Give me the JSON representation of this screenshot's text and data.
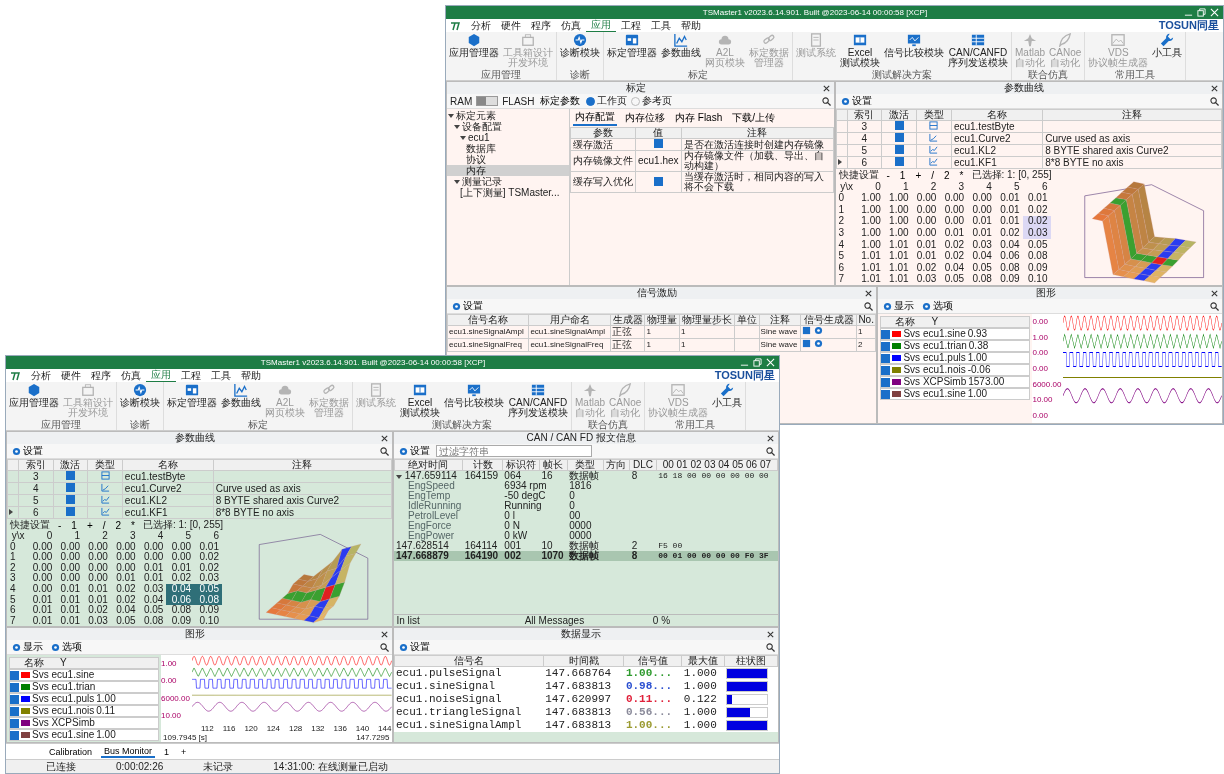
{
  "windows": [
    {
      "title": "TSMaster1 v2023.6.14.901. Built @2023-06-14 00:00:58 [XCP]",
      "brand": "TOSUN同星",
      "menu": [
        {
          "label": "分析",
          "selected": false
        },
        {
          "label": "硬件",
          "selected": false
        },
        {
          "label": "程序",
          "selected": false
        },
        {
          "label": "仿真",
          "selected": false
        },
        {
          "label": "应用",
          "selected": true
        },
        {
          "label": "工程",
          "selected": false
        },
        {
          "label": "工具",
          "selected": false
        },
        {
          "label": "帮助",
          "selected": false
        }
      ],
      "ribbon": [
        {
          "group": "应用管理",
          "buttons": [
            {
              "lines": [
                "应用管理器"
              ],
              "kind": "hex",
              "disabled": false
            },
            {
              "lines": [
                "工具箱设计",
                "开发环境"
              ],
              "kind": "box",
              "disabled": true
            }
          ]
        },
        {
          "group": "诊断",
          "buttons": [
            {
              "lines": [
                "诊断模块"
              ],
              "kind": "pulse",
              "disabled": false
            }
          ]
        },
        {
          "group": "标定",
          "buttons": [
            {
              "lines": [
                "标定管理器"
              ],
              "kind": "window",
              "disabled": false
            },
            {
              "lines": [
                "参数曲线"
              ],
              "kind": "chart",
              "disabled": false
            },
            {
              "lines": [
                "A2L",
                "网页模块"
              ],
              "kind": "cloud",
              "disabled": true
            },
            {
              "lines": [
                "标定数据",
                "管理器"
              ],
              "kind": "link",
              "disabled": true
            }
          ]
        },
        {
          "group": "测试解决方案",
          "buttons": [
            {
              "lines": [
                "测试系统"
              ],
              "kind": "doc",
              "disabled": true
            },
            {
              "lines": [
                "Excel",
                "测试模块"
              ],
              "kind": "sheet",
              "disabled": false
            },
            {
              "lines": [
                "信号比较模块"
              ],
              "kind": "monitor",
              "disabled": false
            },
            {
              "lines": [
                "CAN/CANFD",
                "序列发送模块"
              ],
              "kind": "table",
              "disabled": false
            }
          ]
        },
        {
          "group": "联合仿真",
          "buttons": [
            {
              "lines": [
                "Matlab",
                "自动化"
              ],
              "kind": "plane",
              "disabled": true
            },
            {
              "lines": [
                "CANoe",
                "自动化"
              ],
              "kind": "feather",
              "disabled": true
            }
          ]
        },
        {
          "group": "常用工具",
          "buttons": [
            {
              "lines": [
                "VDS",
                "协议帧生成器"
              ],
              "kind": "image",
              "disabled": true
            },
            {
              "lines": [
                "小工具"
              ],
              "kind": "wrench",
              "disabled": false
            }
          ]
        }
      ],
      "rows": [
        [
          {
            "kind": "calibration",
            "title": "标定",
            "ram": "RAM",
            "flash": "FLASH",
            "flash_selected": false,
            "param_menu": "标定参数",
            "pages": [
              {
                "label": "工作页",
                "selected": true
              },
              {
                "label": "参考页",
                "selected": false
              }
            ],
            "tree": [
              {
                "label": "标定元素",
                "selected": false,
                "expanded": true,
                "children": [
                  {
                    "label": "设备配置",
                    "selected": false,
                    "expanded": true,
                    "children": [
                      {
                        "label": "ecu1",
                        "selected": false,
                        "expanded": true,
                        "children": [
                          {
                            "label": "数据库",
                            "selected": false
                          },
                          {
                            "label": "协议",
                            "selected": false
                          },
                          {
                            "label": "内存",
                            "selected": true
                          }
                        ]
                      }
                    ]
                  },
                  {
                    "label": "测量记录",
                    "selected": false,
                    "expanded": true,
                    "children": [
                      {
                        "label": "[上下测量] TSMaster...",
                        "selected": false
                      }
                    ]
                  }
                ]
              }
            ],
            "tabs": [
              {
                "label": "内存配置",
                "selected": true
              },
              {
                "label": "内存位移",
                "selected": false
              },
              {
                "label": "内存 Flash",
                "selected": false
              },
              {
                "label": "下载/上传",
                "selected": false
              }
            ],
            "columns": [
              "参数",
              "值",
              "注释"
            ],
            "params": [
              {
                "name": "缓存激活",
                "kind": "check",
                "checked": true,
                "note": "是否在激活连接时创建内存镜像"
              },
              {
                "name": "内存镜像文件",
                "kind": "text",
                "value": "ecu1.hex",
                "note": "内存镜像文件（加载、导出、自动构建）"
              },
              {
                "name": "缓存写入优化",
                "kind": "check",
                "checked": true,
                "note": "当缓存激活时，相同内容的写入将不会下载"
              }
            ]
          },
          {
            "kind": "param_curve",
            "title": "参数曲线",
            "settings": "设置",
            "columns": [
              "索引",
              "激活",
              "类型",
              "名称",
              "注释"
            ],
            "items": [
              {
                "index": "3",
                "active": true,
                "kind": "value",
                "name": "ecu1.testByte",
                "selected": false
              },
              {
                "index": "4",
                "active": true,
                "kind": "curve",
                "name": "ecu1.Curve2",
                "note": "Curve used as axis",
                "selected": false
              },
              {
                "index": "5",
                "active": true,
                "kind": "map",
                "name": "ecu1.KL2",
                "note": "8 BYTE shared axis Curve2",
                "selected": false
              },
              {
                "index": "6",
                "active": true,
                "kind": "map",
                "name": "ecu1.KF1",
                "note": "8*8 BYTE no axis",
                "selected": true
              }
            ],
            "quick": "快捷设置",
            "ops": [
              "-",
              "1",
              "+",
              "/",
              "2",
              "*"
            ],
            "selection": "已选择: 1: [0, 255]",
            "corner": "y\\x",
            "map_columns": [
              "0",
              "1",
              "2",
              "3",
              "4",
              "5",
              "6"
            ],
            "map_rows": [
              {
                "label": "0",
                "cells": [
                  {
                    "v": "1.00",
                    "selected": false
                  },
                  {
                    "v": "1.00",
                    "selected": false
                  },
                  {
                    "v": "0.00",
                    "selected": false
                  },
                  {
                    "v": "0.00",
                    "selected": false
                  },
                  {
                    "v": "0.00",
                    "selected": false
                  },
                  {
                    "v": "0.01",
                    "selected": false
                  },
                  {
                    "v": "0.01",
                    "selected": false
                  }
                ]
              },
              {
                "label": "1",
                "cells": [
                  {
                    "v": "1.00",
                    "selected": false
                  },
                  {
                    "v": "1.00",
                    "selected": false
                  },
                  {
                    "v": "0.00",
                    "selected": false
                  },
                  {
                    "v": "0.00",
                    "selected": false
                  },
                  {
                    "v": "0.00",
                    "selected": false
                  },
                  {
                    "v": "0.01",
                    "selected": false
                  },
                  {
                    "v": "0.02",
                    "selected": false
                  }
                ]
              },
              {
                "label": "2",
                "cells": [
                  {
                    "v": "1.00",
                    "selected": false
                  },
                  {
                    "v": "1.00",
                    "selected": false
                  },
                  {
                    "v": "0.00",
                    "selected": false
                  },
                  {
                    "v": "0.00",
                    "selected": false
                  },
                  {
                    "v": "0.01",
                    "selected": false
                  },
                  {
                    "v": "0.01",
                    "selected": false
                  },
                  {
                    "v": "0.02",
                    "selected": true
                  }
                ]
              },
              {
                "label": "3",
                "cells": [
                  {
                    "v": "1.00",
                    "selected": false
                  },
                  {
                    "v": "1.00",
                    "selected": false
                  },
                  {
                    "v": "0.00",
                    "selected": false
                  },
                  {
                    "v": "0.01",
                    "selected": false
                  },
                  {
                    "v": "0.01",
                    "selected": false
                  },
                  {
                    "v": "0.02",
                    "selected": false
                  },
                  {
                    "v": "0.03",
                    "selected": true
                  }
                ]
              },
              {
                "label": "4",
                "cells": [
                  {
                    "v": "1.00",
                    "selected": false
                  },
                  {
                    "v": "1.01",
                    "selected": false
                  },
                  {
                    "v": "0.01",
                    "selected": false
                  },
                  {
                    "v": "0.02",
                    "selected": false
                  },
                  {
                    "v": "0.03",
                    "selected": false
                  },
                  {
                    "v": "0.04",
                    "selected": false
                  },
                  {
                    "v": "0.05",
                    "selected": false
                  }
                ]
              },
              {
                "label": "5",
                "cells": [
                  {
                    "v": "1.01",
                    "selected": false
                  },
                  {
                    "v": "1.01",
                    "selected": false
                  },
                  {
                    "v": "0.01",
                    "selected": false
                  },
                  {
                    "v": "0.02",
                    "selected": false
                  },
                  {
                    "v": "0.04",
                    "selected": false
                  },
                  {
                    "v": "0.06",
                    "selected": false
                  },
                  {
                    "v": "0.08",
                    "selected": false
                  }
                ]
              },
              {
                "label": "6",
                "cells": [
                  {
                    "v": "1.01",
                    "selected": false
                  },
                  {
                    "v": "1.01",
                    "selected": false
                  },
                  {
                    "v": "0.02",
                    "selected": false
                  },
                  {
                    "v": "0.04",
                    "selected": false
                  },
                  {
                    "v": "0.05",
                    "selected": false
                  },
                  {
                    "v": "0.08",
                    "selected": false
                  },
                  {
                    "v": "0.09",
                    "selected": false
                  }
                ]
              },
              {
                "label": "7",
                "cells": [
                  {
                    "v": "1.01",
                    "selected": false
                  },
                  {
                    "v": "1.01",
                    "selected": false
                  },
                  {
                    "v": "0.03",
                    "selected": false
                  },
                  {
                    "v": "0.05",
                    "selected": false
                  },
                  {
                    "v": "0.08",
                    "selected": false
                  },
                  {
                    "v": "0.09",
                    "selected": false
                  },
                  {
                    "v": "0.10",
                    "selected": false
                  }
                ]
              }
            ]
          }
        ],
        [
          {
            "kind": "signal_gen",
            "title": "信号激励",
            "settings": "设置",
            "columns": [
              "信号名称",
              "用户命名",
              "生成器",
              "物理量",
              "物理量步长",
              "单位",
              "注释",
              "信号生成器",
              "No."
            ],
            "items": [
              {
                "name": "ecu1.sineSignalAmpl",
                "user": "ecu1.sineSignalAmpl",
                "gen": "正弦",
                "phys": "1",
                "step": "1",
                "note": "Sine wave",
                "no": "1"
              },
              {
                "name": "ecu1.sineSignalFreq",
                "user": "ecu1.sineSignalFreq",
                "gen": "正弦",
                "phys": "1",
                "step": "1",
                "note": "Sine wave",
                "no": "2"
              }
            ]
          },
          {
            "kind": "graph",
            "title": "图形",
            "menus": [
              "显示",
              "选项"
            ],
            "legend_header": [
              "名称",
              "Y"
            ],
            "legend": [
              {
                "label": "Svs ecu1.sine",
                "value": "0.93",
                "color": "#ff0000",
                "checked": true,
                "kind": "sine"
              },
              {
                "label": "Svs ecu1.trian",
                "value": "0.38",
                "color": "#008000",
                "checked": true,
                "kind": "triangle"
              },
              {
                "label": "Svs ecu1.puls",
                "value": "1.00",
                "color": "#0000ff",
                "checked": true,
                "kind": "square"
              },
              {
                "label": "Svs ecu1.nois",
                "value": "-0.06",
                "color": "#808000",
                "checked": true,
                "kind": "flat"
              },
              {
                "label": "Svs XCPSimb",
                "value": "1573.00",
                "color": "#800080",
                "checked": true,
                "kind": "slow"
              },
              {
                "label": "Svs ecu1.sine",
                "value": "1.00",
                "color": "#804040",
                "checked": true,
                "kind": "none"
              }
            ],
            "y_labels": [
              "0.00",
              "1.00",
              "0.00",
              "0.00",
              "6000.00",
              "10.00",
              "0.00"
            ]
          }
        ]
      ]
    },
    {
      "title": "TSMaster1 v2023.6.14.901. Built @2023-06-14 00:00:58 [XCP]",
      "brand": "TOSUN同星",
      "menu": [
        {
          "label": "分析",
          "selected": false
        },
        {
          "label": "硬件",
          "selected": false
        },
        {
          "label": "程序",
          "selected": false
        },
        {
          "label": "仿真",
          "selected": false
        },
        {
          "label": "应用",
          "selected": true
        },
        {
          "label": "工程",
          "selected": false
        },
        {
          "label": "工具",
          "selected": false
        },
        {
          "label": "帮助",
          "selected": false
        }
      ],
      "ribbon": [
        {
          "group": "应用管理",
          "buttons": [
            {
              "lines": [
                "应用管理器"
              ],
              "kind": "hex",
              "disabled": false
            },
            {
              "lines": [
                "工具箱设计",
                "开发环境"
              ],
              "kind": "box",
              "disabled": true
            }
          ]
        },
        {
          "group": "诊断",
          "buttons": [
            {
              "lines": [
                "诊断模块"
              ],
              "kind": "pulse",
              "disabled": false
            }
          ]
        },
        {
          "group": "标定",
          "buttons": [
            {
              "lines": [
                "标定管理器"
              ],
              "kind": "window",
              "disabled": false
            },
            {
              "lines": [
                "参数曲线"
              ],
              "kind": "chart",
              "disabled": false
            },
            {
              "lines": [
                "A2L",
                "网页模块"
              ],
              "kind": "cloud",
              "disabled": true
            },
            {
              "lines": [
                "标定数据",
                "管理器"
              ],
              "kind": "link",
              "disabled": true
            }
          ]
        },
        {
          "group": "测试解决方案",
          "buttons": [
            {
              "lines": [
                "测试系统"
              ],
              "kind": "doc",
              "disabled": true
            },
            {
              "lines": [
                "Excel",
                "测试模块"
              ],
              "kind": "sheet",
              "disabled": false
            },
            {
              "lines": [
                "信号比较模块"
              ],
              "kind": "monitor",
              "disabled": false
            },
            {
              "lines": [
                "CAN/CANFD",
                "序列发送模块"
              ],
              "kind": "table",
              "disabled": false
            }
          ]
        },
        {
          "group": "联合仿真",
          "buttons": [
            {
              "lines": [
                "Matlab",
                "自动化"
              ],
              "kind": "plane",
              "disabled": true
            },
            {
              "lines": [
                "CANoe",
                "自动化"
              ],
              "kind": "feather",
              "disabled": true
            }
          ]
        },
        {
          "group": "常用工具",
          "buttons": [
            {
              "lines": [
                "VDS",
                "协议帧生成器"
              ],
              "kind": "image",
              "disabled": true
            },
            {
              "lines": [
                "小工具"
              ],
              "kind": "wrench",
              "disabled": false
            }
          ]
        }
      ],
      "rows": [
        [
          {
            "kind": "param_curve",
            "title": "参数曲线",
            "settings": "设置",
            "columns": [
              "索引",
              "激活",
              "类型",
              "名称",
              "注释"
            ],
            "items": [
              {
                "index": "3",
                "active": true,
                "kind": "value",
                "name": "ecu1.testByte",
                "selected": false
              },
              {
                "index": "4",
                "active": true,
                "kind": "curve",
                "name": "ecu1.Curve2",
                "note": "Curve used as axis",
                "selected": false
              },
              {
                "index": "5",
                "active": true,
                "kind": "map",
                "name": "ecu1.KL2",
                "note": "8 BYTE shared axis Curve2",
                "selected": false
              },
              {
                "index": "6",
                "active": true,
                "kind": "map",
                "name": "ecu1.KF1",
                "note": "8*8 BYTE no axis",
                "selected": true
              }
            ],
            "quick": "快捷设置",
            "ops": [
              "-",
              "1",
              "+",
              "/",
              "2",
              "*"
            ],
            "selection": "已选择: 1: [0, 255]",
            "corner": "y\\x",
            "map_columns": [
              "0",
              "1",
              "2",
              "3",
              "4",
              "5",
              "6"
            ],
            "map_rows": [
              {
                "label": "0",
                "cells": [
                  {
                    "v": "0.00",
                    "selected": false
                  },
                  {
                    "v": "0.00",
                    "selected": false
                  },
                  {
                    "v": "0.00",
                    "selected": false
                  },
                  {
                    "v": "0.00",
                    "selected": false
                  },
                  {
                    "v": "0.00",
                    "selected": false
                  },
                  {
                    "v": "0.00",
                    "selected": false
                  },
                  {
                    "v": "0.01",
                    "selected": false
                  }
                ]
              },
              {
                "label": "1",
                "cells": [
                  {
                    "v": "0.00",
                    "selected": false
                  },
                  {
                    "v": "0.00",
                    "selected": false
                  },
                  {
                    "v": "0.00",
                    "selected": false
                  },
                  {
                    "v": "0.00",
                    "selected": false
                  },
                  {
                    "v": "0.00",
                    "selected": false
                  },
                  {
                    "v": "0.00",
                    "selected": false
                  },
                  {
                    "v": "0.02",
                    "selected": false
                  }
                ]
              },
              {
                "label": "2",
                "cells": [
                  {
                    "v": "0.00",
                    "selected": false
                  },
                  {
                    "v": "0.00",
                    "selected": false
                  },
                  {
                    "v": "0.00",
                    "selected": false
                  },
                  {
                    "v": "0.00",
                    "selected": false
                  },
                  {
                    "v": "0.01",
                    "selected": false
                  },
                  {
                    "v": "0.01",
                    "selected": false
                  },
                  {
                    "v": "0.02",
                    "selected": false
                  }
                ]
              },
              {
                "label": "3",
                "cells": [
                  {
                    "v": "0.00",
                    "selected": false
                  },
                  {
                    "v": "0.00",
                    "selected": false
                  },
                  {
                    "v": "0.00",
                    "selected": false
                  },
                  {
                    "v": "0.01",
                    "selected": false
                  },
                  {
                    "v": "0.01",
                    "selected": false
                  },
                  {
                    "v": "0.02",
                    "selected": false
                  },
                  {
                    "v": "0.03",
                    "selected": false
                  }
                ]
              },
              {
                "label": "4",
                "cells": [
                  {
                    "v": "0.00",
                    "selected": false
                  },
                  {
                    "v": "0.01",
                    "selected": false
                  },
                  {
                    "v": "0.01",
                    "selected": false
                  },
                  {
                    "v": "0.02",
                    "selected": false
                  },
                  {
                    "v": "0.03",
                    "selected": false
                  },
                  {
                    "v": "0.04",
                    "selected": true
                  },
                  {
                    "v": "0.05",
                    "selected": true
                  }
                ]
              },
              {
                "label": "5",
                "cells": [
                  {
                    "v": "0.01",
                    "selected": false
                  },
                  {
                    "v": "0.01",
                    "selected": false
                  },
                  {
                    "v": "0.01",
                    "selected": false
                  },
                  {
                    "v": "0.02",
                    "selected": false
                  },
                  {
                    "v": "0.04",
                    "selected": false
                  },
                  {
                    "v": "0.06",
                    "selected": true
                  },
                  {
                    "v": "0.08",
                    "selected": true
                  }
                ]
              },
              {
                "label": "6",
                "cells": [
                  {
                    "v": "0.01",
                    "selected": false
                  },
                  {
                    "v": "0.01",
                    "selected": false
                  },
                  {
                    "v": "0.02",
                    "selected": false
                  },
                  {
                    "v": "0.04",
                    "selected": false
                  },
                  {
                    "v": "0.05",
                    "selected": false
                  },
                  {
                    "v": "0.08",
                    "selected": false
                  },
                  {
                    "v": "0.09",
                    "selected": false
                  }
                ]
              },
              {
                "label": "7",
                "cells": [
                  {
                    "v": "0.01",
                    "selected": false
                  },
                  {
                    "v": "0.01",
                    "selected": false
                  },
                  {
                    "v": "0.03",
                    "selected": false
                  },
                  {
                    "v": "0.05",
                    "selected": false
                  },
                  {
                    "v": "0.08",
                    "selected": false
                  },
                  {
                    "v": "0.09",
                    "selected": false
                  },
                  {
                    "v": "0.10",
                    "selected": false
                  }
                ]
              }
            ]
          },
          {
            "kind": "can_trace",
            "title": "CAN / CAN FD 报文信息",
            "settings": "设置",
            "filter": {
              "placeholder": "过滤字符串"
            },
            "columns": [
              "绝对时间",
              "计数",
              "标识符",
              "帧长",
              "类型",
              "方向",
              "DLC",
              "00 01 02 03 04 05 06 07"
            ],
            "frames": [
              {
                "time": "147.659114",
                "count": "164159",
                "id": "064",
                "len": "16",
                "type": "数据帧",
                "dlc": "8",
                "data": "16 18 00 00 00 00 00 00",
                "selected": false,
                "expanded": true,
                "signals": [
                  {
                    "name": "EngSpeed",
                    "value": "6934 rpm",
                    "raw": "1816"
                  },
                  {
                    "name": "EngTemp",
                    "value": "-50 degC",
                    "raw": "0"
                  },
                  {
                    "name": "IdleRunning",
                    "value": "Running",
                    "raw": "0"
                  },
                  {
                    "name": "PetrolLevel",
                    "value": "0 l",
                    "raw": "00"
                  },
                  {
                    "name": "EngForce",
                    "value": "0 N",
                    "raw": "0000"
                  },
                  {
                    "name": "EngPower",
                    "value": "0 kW",
                    "raw": "0000"
                  }
                ]
              },
              {
                "time": "147.628514",
                "count": "164114",
                "id": "001",
                "len": "10",
                "type": "数据帧",
                "dlc": "2",
                "data": "F5 00",
                "selected": false
              },
              {
                "time": "147.668879",
                "count": "164190",
                "id": "002",
                "len": "1070",
                "type": "数据帧",
                "dlc": "8",
                "data": "00 01 00 00 00 00 F0 3F",
                "selected": true
              }
            ],
            "footer": [
              "In list",
              "All Messages",
              "0 %"
            ]
          }
        ],
        [
          {
            "kind": "graph",
            "title": "图形",
            "menus": [
              "显示",
              "选项"
            ],
            "legend_header": [
              "名称",
              "Y"
            ],
            "legend": [
              {
                "label": "Svs ecu1.sine",
                "color": "#ff0000",
                "checked": true,
                "kind": "sine"
              },
              {
                "label": "Svs ecu1.trian",
                "color": "#008000",
                "checked": true,
                "kind": "triangle"
              },
              {
                "label": "Svs ecu1.puls",
                "value": "1.00",
                "color": "#0000ff",
                "checked": true,
                "kind": "square"
              },
              {
                "label": "Svs ecu1.nois",
                "value": "0.11",
                "color": "#808000",
                "checked": true,
                "kind": "flat"
              },
              {
                "label": "Svs XCPSimb",
                "color": "#800080",
                "checked": true,
                "kind": "slow"
              },
              {
                "label": "Svs ecu1.sine",
                "value": "1.00",
                "color": "#804040",
                "checked": true,
                "kind": "none"
              }
            ],
            "y_labels": [
              "1.00",
              "0.00",
              "6000.00",
              "10.00"
            ],
            "x_labels": [
              "112",
              "116",
              "120",
              "124",
              "128",
              "132",
              "136",
              "140",
              "144"
            ],
            "x_start": "109.7945 [s]",
            "x_end": "147.7295"
          },
          {
            "kind": "data_display",
            "title": "数据显示",
            "settings": "设置",
            "columns": [
              "信号名",
              "时间戳",
              "信号值",
              "最大值",
              "柱状图"
            ],
            "items": [
              {
                "name": "ecu1.pulseSignal",
                "time": "147.668764",
                "value": "1.00...",
                "max": "1.000",
                "color": "#2e9a2e",
                "level": 1.0
              },
              {
                "name": "ecu1.sineSignal",
                "time": "147.683813",
                "value": "0.98...",
                "max": "1.000",
                "color": "#2a4fd0",
                "level": 0.98
              },
              {
                "name": "ecu1.noiseSignal",
                "time": "147.620997",
                "value": "0.11...",
                "max": "0.122",
                "color": "#e0203a",
                "level": 0.11
              },
              {
                "name": "ecu1.triangleSignal",
                "time": "147.683813",
                "value": "0.56...",
                "max": "1.000",
                "color": "#8a8a9a",
                "level": 0.56
              },
              {
                "name": "ecu1.sineSignalAmpl",
                "time": "147.683813",
                "value": "1.00...",
                "max": "1.000",
                "color": "#9a9a30",
                "level": 1.0
              }
            ]
          }
        ]
      ],
      "doc_tabs": [
        {
          "label": "Calibration",
          "selected": false
        },
        {
          "label": "Bus Monitor",
          "selected": true
        },
        {
          "label": "1",
          "selected": false
        }
      ],
      "add_tab": "+",
      "status_bar": [
        "已连接",
        "0:00:02:26",
        "未记录",
        "14:31:00: 在线测量已启动"
      ]
    }
  ]
}
